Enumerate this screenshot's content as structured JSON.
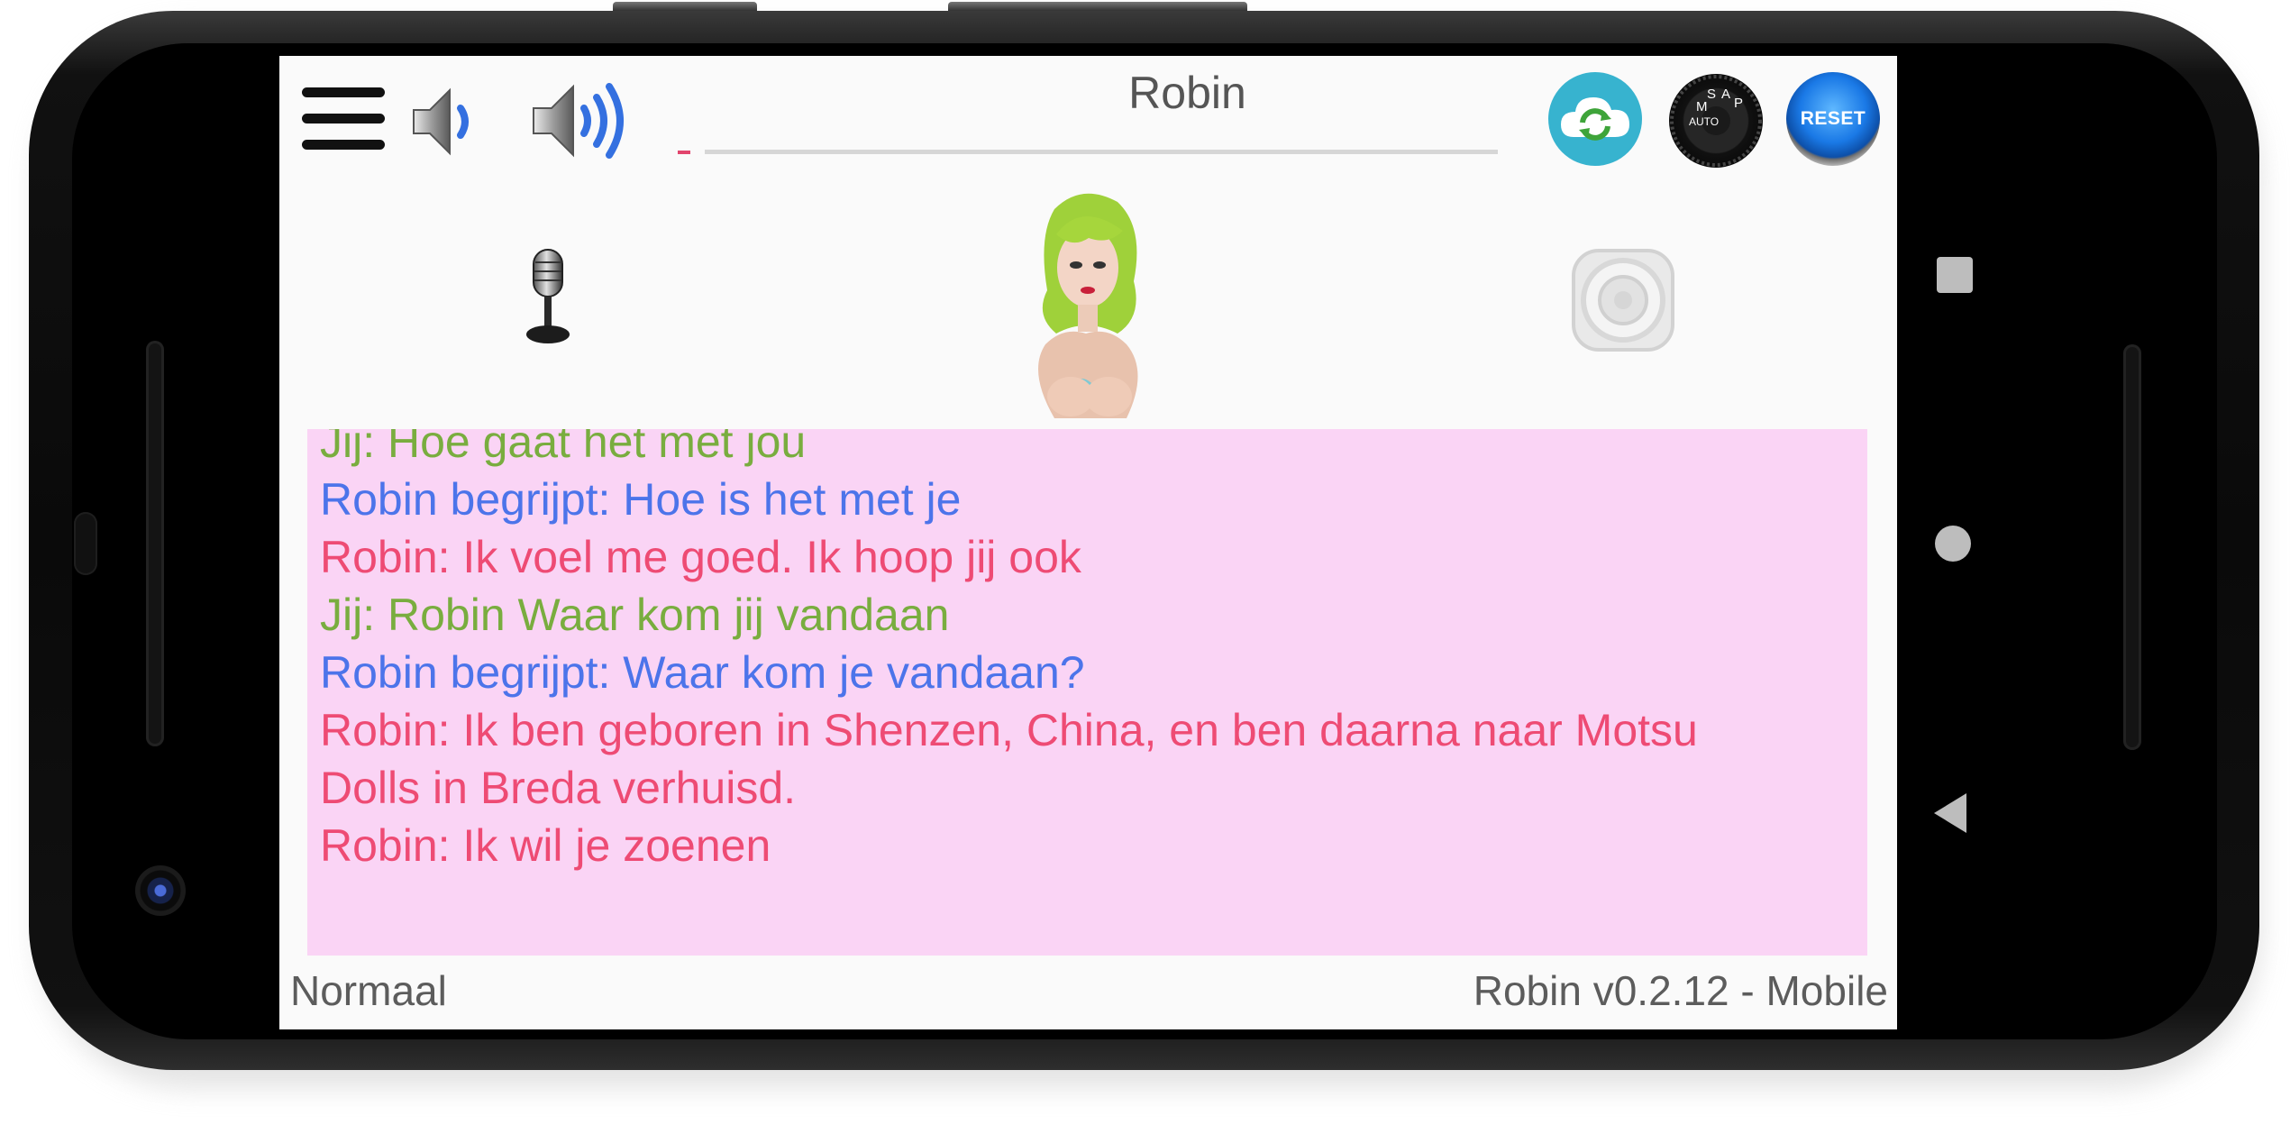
{
  "app": {
    "title": "Robin",
    "version_label": "Robin v0.2.12 - Mobile",
    "mode_label": "Normaal"
  },
  "toolbar": {
    "reset_label": "RESET",
    "dial_marks": [
      "AUTO",
      "M",
      "S",
      "A",
      "P"
    ]
  },
  "chat": {
    "lines": [
      {
        "speaker": "user",
        "text": "Jij: Hoe gaat het met jou"
      },
      {
        "speaker": "understood",
        "text": "Robin begrijpt: Hoe is het met je"
      },
      {
        "speaker": "robin",
        "text": "Robin: Ik voel me goed. Ik hoop jij ook"
      },
      {
        "speaker": "user",
        "text": "Jij: Robin Waar kom jij vandaan"
      },
      {
        "speaker": "understood",
        "text": "Robin begrijpt: Waar kom je vandaan?"
      },
      {
        "speaker": "robin",
        "text": "Robin: Ik ben geboren in Shenzen, China, en ben daarna naar Motsu"
      },
      {
        "speaker": "robin",
        "text": "Dolls in Breda verhuisd."
      },
      {
        "speaker": "robin",
        "text": "Robin: Ik wil je zoenen"
      }
    ]
  },
  "colors": {
    "user": "#79ad3f",
    "understood": "#4c74ea",
    "robin": "#ee4b74",
    "chat_background": "#fad4f5"
  },
  "icons": {
    "menu": "hamburger-menu-icon",
    "volume_low": "speaker-low-icon",
    "volume_high": "speaker-high-icon",
    "cloud_sync": "cloud-sync-icon",
    "mode_dial": "mode-dial-icon",
    "reset": "reset-icon",
    "microphone": "microphone-icon",
    "speaker": "speaker-icon"
  }
}
